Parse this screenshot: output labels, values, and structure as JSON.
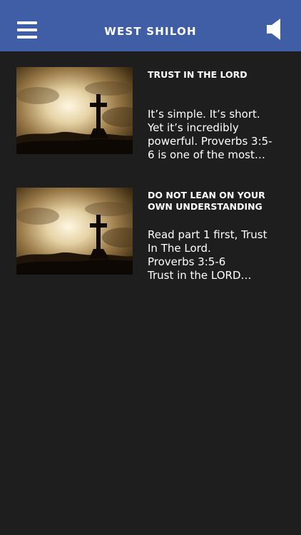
{
  "header": {
    "title": "WEST SHILOH",
    "menu_icon": "hamburger-menu-icon",
    "sound_icon": "speaker-icon",
    "background_color": "#3f5ea5"
  },
  "posts": [
    {
      "title": "TRUST IN THE LORD",
      "excerpt": "It’s simple. It’s short.\nYet it’s incredibly\npowerful. Proverbs 3:5-\n6 is one of the most…",
      "thumbnail_icon": "cross-at-sunset-image"
    },
    {
      "title": "DO NOT LEAN ON YOUR OWN UNDERSTANDING",
      "excerpt": "Read part 1 first, Trust\nIn The Lord.\nProverbs 3:5-6\nTrust in the LORD…",
      "thumbnail_icon": "cross-at-sunset-image"
    }
  ],
  "colors": {
    "page_background": "#1e1e1e",
    "text": "#ffffff"
  }
}
